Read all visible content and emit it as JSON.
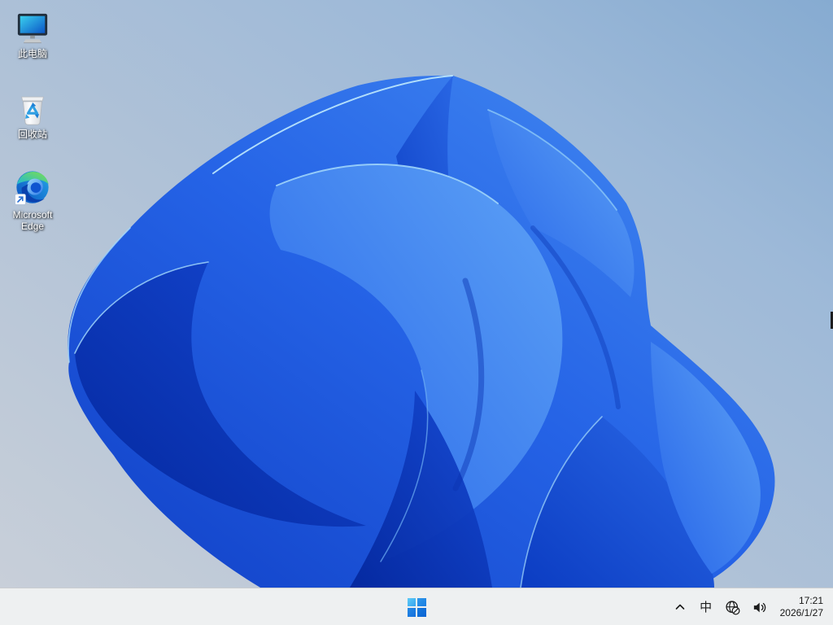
{
  "desktop": {
    "icons": [
      {
        "id": "this-pc",
        "label": "此电脑",
        "icon": "this-pc-icon"
      },
      {
        "id": "recycle-bin",
        "label": "回收站",
        "icon": "recycle-bin-icon"
      },
      {
        "id": "microsoft-edge",
        "label": "Microsoft Edge",
        "icon": "edge-icon",
        "shortcut_overlay": true
      }
    ]
  },
  "taskbar": {
    "start": {
      "icon": "windows-logo-icon"
    },
    "tray": {
      "hidden_icons": {
        "icon": "chevron-up-icon"
      },
      "ime_label": "中",
      "network": {
        "icon": "globe-no-internet-icon"
      },
      "volume": {
        "icon": "speaker-icon"
      },
      "clock": {
        "time": "17:21",
        "date": "2026/1/27"
      }
    }
  },
  "colors": {
    "taskbar_background": "#eef0f1",
    "taskbar_border": "#c9ccd0",
    "tray_icon": "#1b1b1b",
    "desktop_label_text": "#ffffff",
    "windows_logo_blue": "#0f70da",
    "wallpaper_petal_deep": "#04279d",
    "wallpaper_petal_mid": "#2563e6",
    "wallpaper_petal_bright": "#5da2f6",
    "wallpaper_highlight": "#9fd4fa",
    "wallpaper_background_top_right": "#86abd1",
    "wallpaper_background_bottom_left": "#c8cfd9"
  }
}
